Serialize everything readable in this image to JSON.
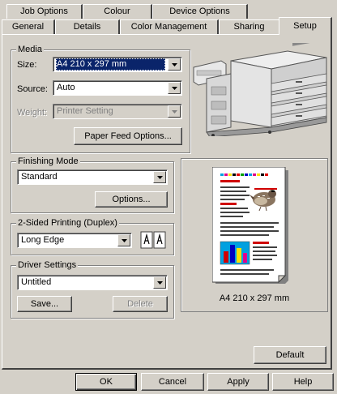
{
  "tabs": {
    "row_back": [
      "Job Options",
      "Colour",
      "Device Options"
    ],
    "row_front": [
      "General",
      "Details",
      "Color Management",
      "Sharing",
      "Setup"
    ],
    "active": "Setup"
  },
  "media": {
    "title": "Media",
    "size_label": "Size:",
    "size_value": "A4 210 x 297 mm",
    "source_label": "Source:",
    "source_value": "Auto",
    "weight_label": "Weight:",
    "weight_value": "Printer Setting",
    "paper_feed_button": "Paper Feed Options..."
  },
  "finishing": {
    "title": "Finishing Mode",
    "value": "Standard",
    "options_button": "Options..."
  },
  "duplex": {
    "title": "2-Sided Printing (Duplex)",
    "value": "Long Edge"
  },
  "driver": {
    "title": "Driver Settings",
    "value": "Untitled",
    "save_button": "Save...",
    "delete_button": "Delete"
  },
  "preview": {
    "caption": "A4 210 x 297 mm"
  },
  "default_button": "Default",
  "footer": {
    "ok": "OK",
    "cancel": "Cancel",
    "apply": "Apply",
    "help": "Help"
  }
}
